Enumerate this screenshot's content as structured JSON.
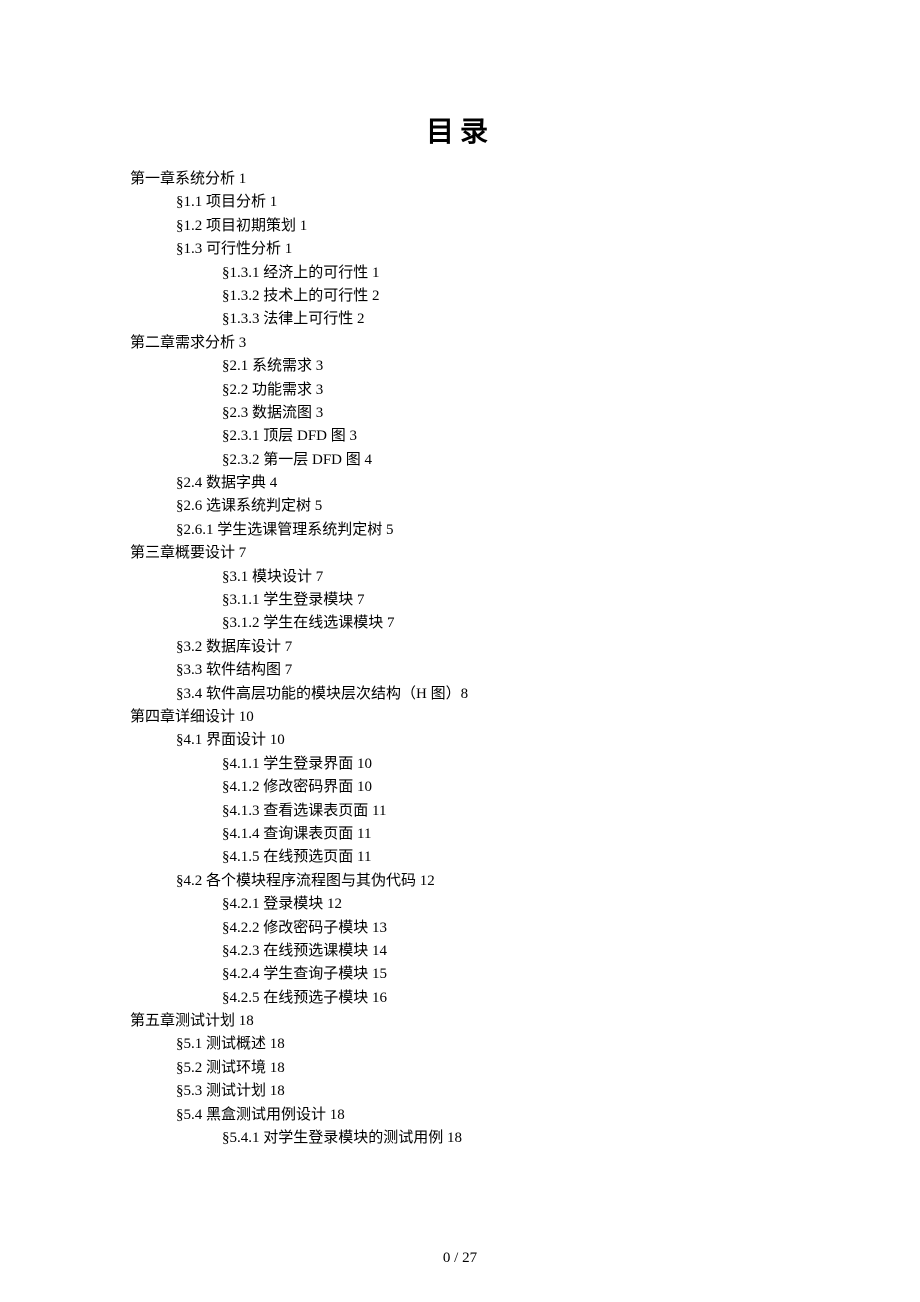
{
  "title": "目录",
  "pageNumber": "0 / 27",
  "entries": [
    {
      "indent": 0,
      "text": "第一章系统分析 1"
    },
    {
      "indent": 1,
      "text": "§1.1  项目分析 1"
    },
    {
      "indent": 1,
      "text": "§1.2  项目初期策划 1"
    },
    {
      "indent": 1,
      "text": "§1.3  可行性分析 1"
    },
    {
      "indent": 2,
      "text": "§1.3.1 经济上的可行性 1"
    },
    {
      "indent": 2,
      "text": "§1.3.2 技术上的可行性 2"
    },
    {
      "indent": 2,
      "text": "§1.3.3 法律上可行性 2"
    },
    {
      "indent": 0,
      "text": "第二章需求分析 3"
    },
    {
      "indent": 2,
      "text": "§2.1  系统需求 3"
    },
    {
      "indent": 2,
      "text": "§2.2  功能需求 3"
    },
    {
      "indent": 2,
      "text": "§2.3  数据流图 3"
    },
    {
      "indent": 2,
      "text": "§2.3.1 顶层 DFD 图 3"
    },
    {
      "indent": 2,
      "text": "§2.3.2  第一层 DFD 图 4"
    },
    {
      "indent": 1,
      "text": "§2.4  数据字典 4"
    },
    {
      "indent": 1,
      "text": "§2.6  选课系统判定树 5"
    },
    {
      "indent": 1,
      "text": "§2.6.1 学生选课管理系统判定树 5"
    },
    {
      "indent": 0,
      "text": "第三章概要设计 7"
    },
    {
      "indent": 2,
      "text": "§3.1 模块设计 7"
    },
    {
      "indent": 2,
      "text": "§3.1.1  学生登录模块 7"
    },
    {
      "indent": 2,
      "text": "§3.1.2  学生在线选课模块 7"
    },
    {
      "indent": 1,
      "text": "§3.2  数据库设计 7"
    },
    {
      "indent": 1,
      "text": "§3.3  软件结构图 7"
    },
    {
      "indent": 1,
      "text": "§3.4  软件高层功能的模块层次结构（H 图）8"
    },
    {
      "indent": 0,
      "text": "第四章详细设计 10"
    },
    {
      "indent": 1,
      "text": "§4.1  界面设计 10"
    },
    {
      "indent": 2,
      "text": "§4.1.1 学生登录界面 10"
    },
    {
      "indent": 2,
      "text": "§4.1.2 修改密码界面 10"
    },
    {
      "indent": 2,
      "text": "§4.1.3 查看选课表页面 11"
    },
    {
      "indent": 2,
      "text": "§4.1.4 查询课表页面 11"
    },
    {
      "indent": 2,
      "text": "§4.1.5 在线预选页面 11"
    },
    {
      "indent": 1,
      "text": "§4.2  各个模块程序流程图与其伪代码 12"
    },
    {
      "indent": 2,
      "text": "§4.2.1  登录模块 12"
    },
    {
      "indent": 2,
      "text": "§4.2.2 修改密码子模块 13"
    },
    {
      "indent": 2,
      "text": "§4.2.3 在线预选课模块 14"
    },
    {
      "indent": 2,
      "text": "§4.2.4 学生查询子模块 15"
    },
    {
      "indent": 2,
      "text": "§4.2.5 在线预选子模块 16"
    },
    {
      "indent": 0,
      "text": "第五章测试计划 18"
    },
    {
      "indent": 1,
      "text": "§5.1  测试概述 18"
    },
    {
      "indent": 1,
      "text": "§5.2  测试环境 18"
    },
    {
      "indent": 1,
      "text": "§5.3  测试计划 18"
    },
    {
      "indent": 1,
      "text": "§5.4  黑盒测试用例设计 18"
    },
    {
      "indent": 2,
      "text": "§5.4.1  对学生登录模块的测试用例 18"
    }
  ]
}
